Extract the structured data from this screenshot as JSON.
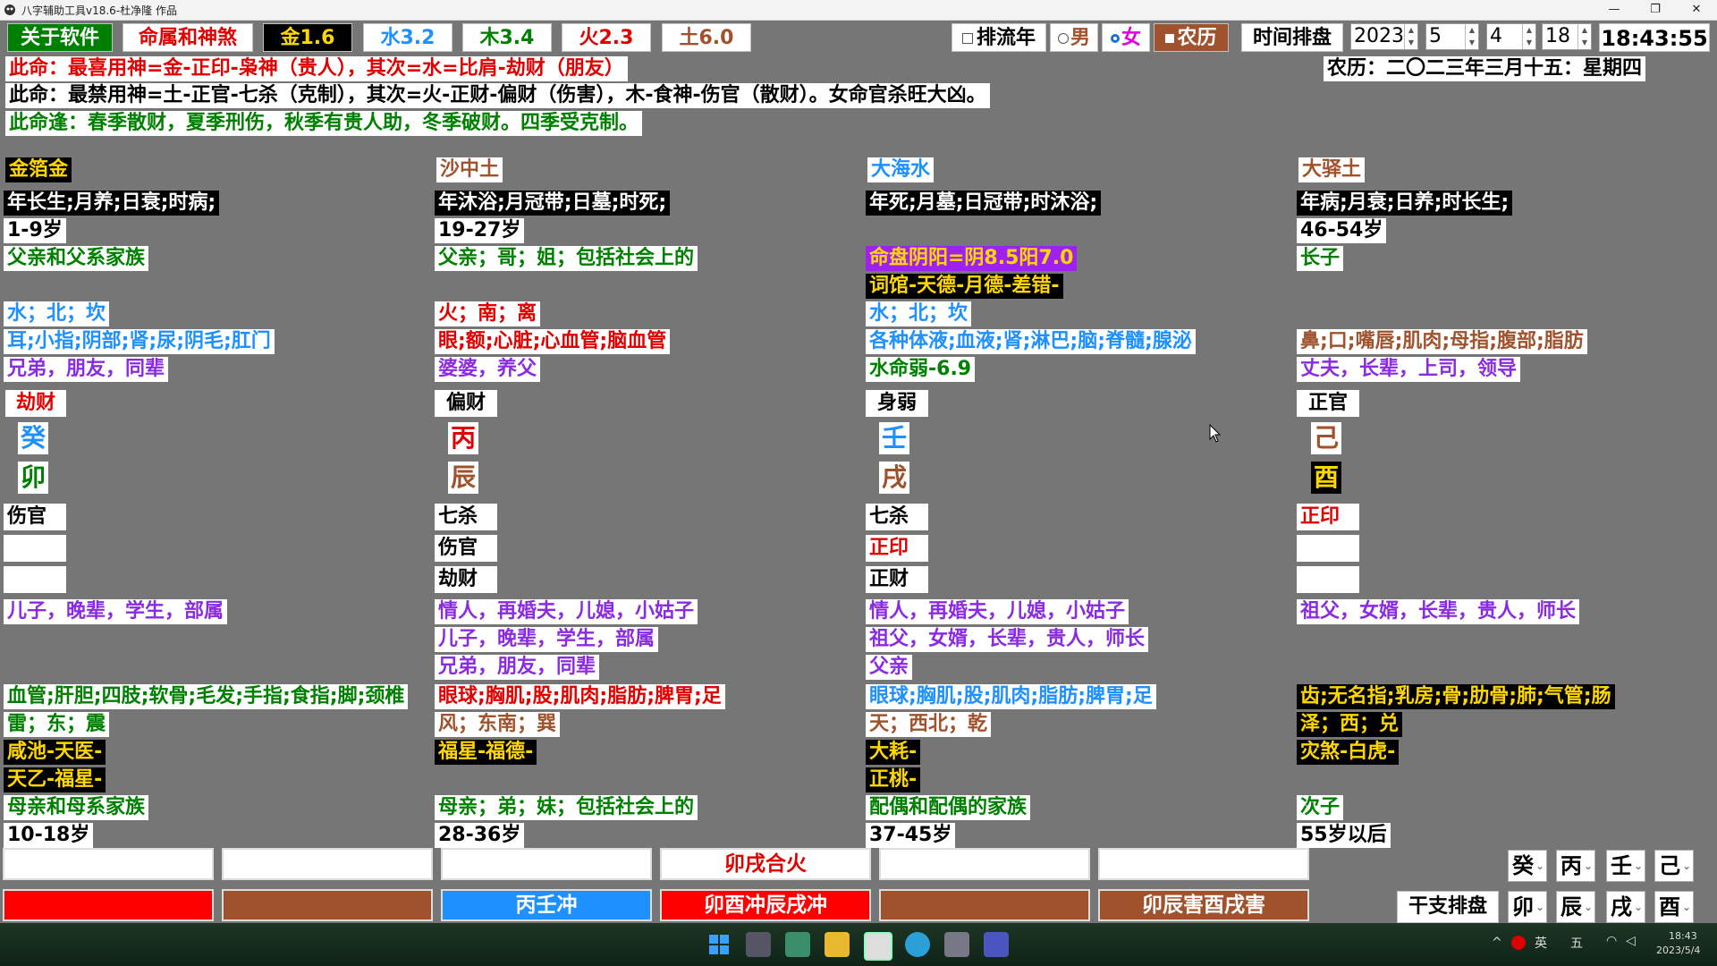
{
  "window": {
    "title": "八字辅助工具v18.6-杜净隆 作品",
    "minimize": "—",
    "maximize": "❐",
    "close": "✕"
  },
  "toolbar": {
    "about": "关于软件",
    "destiny": "命属和神煞",
    "elements": [
      {
        "label": "金1.6",
        "color": "#ffd700"
      },
      {
        "label": "水3.2",
        "color": "#1e90ff"
      },
      {
        "label": "木3.4",
        "color": "#008000"
      },
      {
        "label": "火2.3",
        "color": "#e00000"
      },
      {
        "label": "土6.0",
        "color": "#a0522d"
      }
    ],
    "flow_year": "排流年",
    "male": "男",
    "female": "女",
    "lunar": "农历",
    "time_chart": "时间排盘",
    "year": "2023",
    "month": "5",
    "day": "4",
    "hour": "18",
    "clock": "18:43:55"
  },
  "lunar_date": "农历：二〇二三年三月十五：星期四",
  "summary": {
    "line1": "此命：最喜用神=金-正印-枭神（贵人），其次=水=比肩-劫财（朋友）",
    "line2": "此命：最禁用神=土-正官-七杀（克制），其次=火-正财-偏财（伤害），木-食神-伤官（散财）。女命官杀旺大凶。",
    "line3": "此命逢：春季散财，夏季刑伤，秋季有贵人助，冬季破财。四季受克制。"
  },
  "pillars": [
    {
      "nayin": "金箔金",
      "stages": "年长生;月养;日衰;时病;",
      "age": "1-9岁",
      "family": "父亲和父系家族",
      "direction": "水；北；坎",
      "body": "耳;小指;阴部;肾;尿;阴毛;肛门",
      "relation": "兄弟，朋友，同辈",
      "stem_god": "劫财",
      "stem": "癸",
      "branch": "卯",
      "hidden": [
        "伤官",
        "",
        ""
      ],
      "rel_list": [
        "儿子，晚辈，学生，部属"
      ],
      "body2": "血管;肝胆;四肢;软骨;毛发;手指;食指;脚;颈椎",
      "direction2": "雷；东；震",
      "stars": [
        "咸池-天医-",
        "天乙-福星-"
      ],
      "family2": "母亲和母系家族",
      "age2": "10-18岁"
    },
    {
      "nayin": "沙中土",
      "stages": "年沐浴;月冠带;日墓;时死;",
      "age": "19-27岁",
      "family": "父亲；哥；姐；包括社会上的",
      "direction": "火；南；离",
      "body": "眼;额;心脏;心血管;脑血管",
      "relation": "婆婆，养父",
      "stem_god": "偏财",
      "stem": "丙",
      "branch": "辰",
      "hidden": [
        "七杀",
        "伤官",
        "劫财"
      ],
      "rel_list": [
        "情人，再婚夫，儿媳，小姑子",
        "儿子，晚辈，学生，部属",
        "兄弟，朋友，同辈"
      ],
      "body2": "眼球;胸肌;股;肌肉;脂肪;脾胃;足",
      "direction2": "风；东南；巽",
      "stars": [
        "福星-福德-"
      ],
      "family2": "母亲；弟；妹；包括社会上的",
      "age2": "28-36岁"
    },
    {
      "nayin": "大海水",
      "stages": "年死;月墓;日冠带;时沐浴;",
      "yinyang": "命盘阴阳=阴8.5阳7.0",
      "stars_top": "词馆-天德-月德-差错-",
      "direction": "水；北；坎",
      "body": "各种体液;血液;肾;淋巴;脑;脊髓;腺泌",
      "strength": "水命弱-6.9",
      "stem_god": "身弱",
      "stem": "壬",
      "branch": "戌",
      "hidden": [
        "七杀",
        "正印",
        "正财"
      ],
      "rel_list": [
        "情人，再婚夫，儿媳，小姑子",
        "祖父，女婿，长辈，贵人，师长",
        "父亲"
      ],
      "body2": "眼球;胸肌;股;肌肉;脂肪;脾胃;足",
      "direction2": "天；西北；乾",
      "stars": [
        "大耗-",
        "正桃-"
      ],
      "family2": "配偶和配偶的家族",
      "age2": "37-45岁"
    },
    {
      "nayin": "大驿土",
      "stages": "年病;月衰;日养;时长生;",
      "age": "46-54岁",
      "family": "长子",
      "body": "鼻;口;嘴唇;肌肉;母指;腹部;脂肪",
      "relation": "丈夫，长辈，上司，领导",
      "stem_god": "正官",
      "stem": "己",
      "branch": "酉",
      "hidden": [
        "正印",
        "",
        ""
      ],
      "rel_list": [
        "祖父，女婿，长辈，贵人，师长"
      ],
      "body2": "齿;无名指;乳房;骨;肋骨;肺;气管;肠",
      "direction2": "泽；西；兑",
      "stars": [
        "灾煞-白虎-"
      ],
      "family2": "次子",
      "age2": "55岁以后"
    }
  ],
  "relations_row1": [
    "",
    "",
    "",
    "卯戌合火",
    "",
    ""
  ],
  "relations_row2": [
    {
      "label": "",
      "color": "#ff0000"
    },
    {
      "label": "",
      "color": "#a0522d"
    },
    {
      "label": "丙壬冲",
      "color": "#1e90ff"
    },
    {
      "label": "卯酉冲辰戌冲",
      "color": "#ff0000"
    },
    {
      "label": "",
      "color": "#a0522d"
    },
    {
      "label": "卯辰害酉戌害",
      "color": "#a0522d"
    }
  ],
  "ganzhi": {
    "button": "干支排盘",
    "stems": [
      "癸",
      "丙",
      "壬",
      "己"
    ],
    "branches": [
      "卯",
      "辰",
      "戌",
      "酉"
    ]
  },
  "taskbar": {
    "ime": "英",
    "day_short": "五",
    "time": "18:43",
    "date": "2023/5/4"
  }
}
